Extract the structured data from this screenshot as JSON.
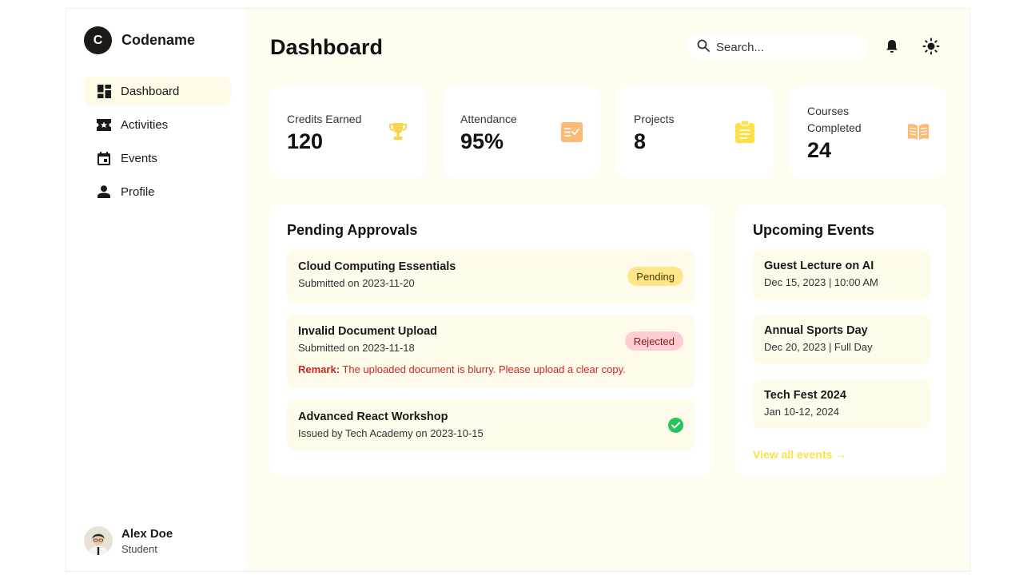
{
  "brand": {
    "logo_letter": "C",
    "name": "Codename"
  },
  "sidebar": {
    "items": [
      {
        "label": "Dashboard",
        "icon": "dashboard-icon",
        "active": true
      },
      {
        "label": "Activities",
        "icon": "ticket-icon",
        "active": false
      },
      {
        "label": "Events",
        "icon": "calendar-icon",
        "active": false
      },
      {
        "label": "Profile",
        "icon": "person-icon",
        "active": false
      }
    ]
  },
  "user": {
    "name": "Alex Doe",
    "role": "Student"
  },
  "header": {
    "title": "Dashboard",
    "search_placeholder": "Search..."
  },
  "stats": [
    {
      "label": "Credits Earned",
      "value": "120",
      "icon": "trophy-icon",
      "color": "#fcd34d"
    },
    {
      "label": "Attendance",
      "value": "95%",
      "icon": "checklist-icon",
      "color": "#fdba74"
    },
    {
      "label": "Projects",
      "value": "8",
      "icon": "clipboard-icon",
      "color": "#fde047"
    },
    {
      "label": "Courses Completed",
      "value": "24",
      "icon": "book-icon",
      "color": "#fdba74"
    }
  ],
  "approvals": {
    "title": "Pending Approvals",
    "items": [
      {
        "title": "Cloud Computing Essentials",
        "sub": "Submitted on 2023-11-20",
        "status": "Pending"
      },
      {
        "title": "Invalid Document Upload",
        "sub": "Submitted on 2023-11-18",
        "status": "Rejected",
        "remark_label": "Remark:",
        "remark_text": " The uploaded document is blurry. Please upload a clear copy."
      },
      {
        "title": "Advanced React Workshop",
        "sub": "Issued by Tech Academy on 2023-10-15",
        "status": "Approved"
      }
    ]
  },
  "events": {
    "title": "Upcoming Events",
    "items": [
      {
        "title": "Guest Lecture on AI",
        "sub": "Dec 15, 2023 | 10:00 AM"
      },
      {
        "title": "Annual Sports Day",
        "sub": "Dec 20, 2023 | Full Day"
      },
      {
        "title": "Tech Fest 2024",
        "sub": "Jan 10-12, 2024"
      }
    ],
    "view_all": "View all events →"
  },
  "colors": {
    "accent": "#fde047",
    "background": "#fffdf0",
    "card": "#fffbea",
    "success": "#22c55e",
    "danger": "#c62828"
  }
}
